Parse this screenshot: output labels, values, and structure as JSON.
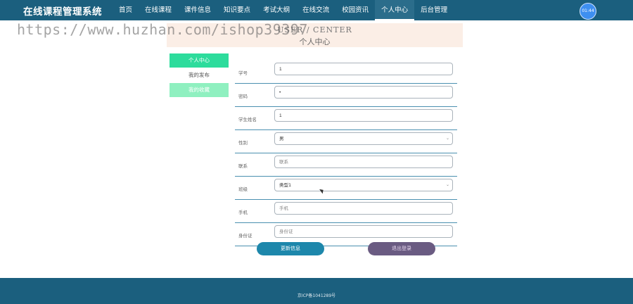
{
  "header": {
    "brand": "在线课程管理系统",
    "nav": [
      {
        "label": "首页"
      },
      {
        "label": "在线课程"
      },
      {
        "label": "课件信息"
      },
      {
        "label": "知识要点"
      },
      {
        "label": "考试大纲"
      },
      {
        "label": "在线交流"
      },
      {
        "label": "校园资讯"
      },
      {
        "label": "个人中心",
        "active": true
      },
      {
        "label": "后台管理"
      }
    ],
    "clock": "01:44"
  },
  "watermark": "https://www.huzhan.com/ishop39397",
  "banner": {
    "title_en": "USER / CENTER",
    "title_cn": "个人中心"
  },
  "sidebar": {
    "items": [
      {
        "label": "个人中心"
      },
      {
        "label": "我的发布"
      },
      {
        "label": "我的收藏"
      }
    ]
  },
  "form": {
    "student_id": {
      "label": "学号",
      "value": "1"
    },
    "password": {
      "label": "密码",
      "value": "•"
    },
    "student_name": {
      "label": "学生姓名",
      "value": "1"
    },
    "gender": {
      "label": "性别",
      "value": "男"
    },
    "contact": {
      "label": "联系",
      "placeholder": "联系"
    },
    "class": {
      "label": "班级",
      "value": "类型1"
    },
    "phone": {
      "label": "手机",
      "placeholder": "手机"
    },
    "id_card": {
      "label": "身份证",
      "placeholder": "身份证"
    }
  },
  "buttons": {
    "update": "更新信息",
    "logout": "退出登录"
  },
  "footer": {
    "icp": "京ICP备1041289号"
  },
  "colors": {
    "header_bg": "#1b5f7e",
    "sidebar_active": "#2ddc9c",
    "update_button": "#1d87ab",
    "logout_button": "#6a5b82"
  }
}
